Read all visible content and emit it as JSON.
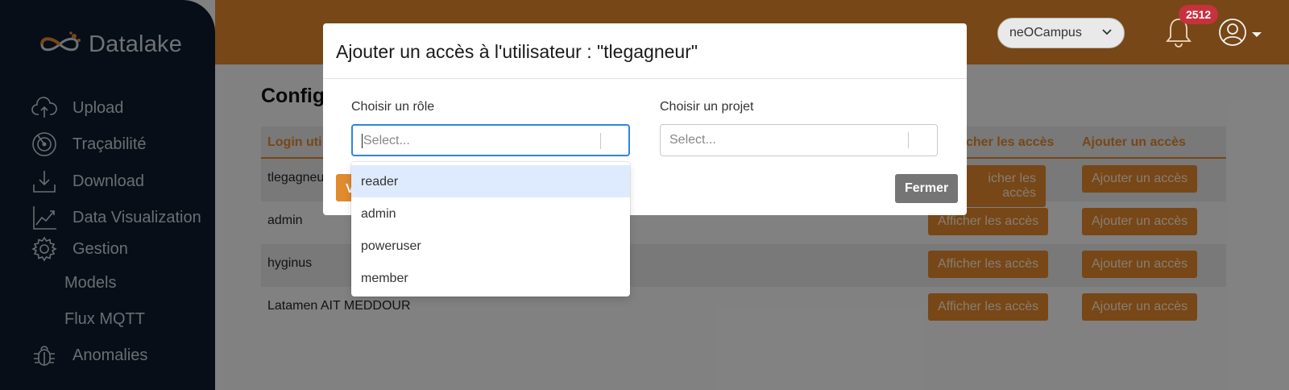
{
  "app": {
    "logo_text": "Datalake"
  },
  "sidebar": {
    "items": [
      {
        "label": "Upload",
        "icon": "cloud-upload-icon"
      },
      {
        "label": "Traçabilité",
        "icon": "target-icon"
      },
      {
        "label": "Download",
        "icon": "download-icon"
      },
      {
        "label": "Data Visualization",
        "icon": "chart-line-icon"
      },
      {
        "label": "Gestion",
        "icon": "gear-icon"
      }
    ],
    "sub_items": [
      {
        "label": "Models"
      },
      {
        "label": "Flux MQTT"
      }
    ],
    "bottom_items": [
      {
        "label": "Anomalies",
        "icon": "bug-icon"
      }
    ]
  },
  "header": {
    "campus_select": "neOCampus",
    "notification_count": "2512",
    "icons": [
      "bell-icon",
      "user-avatar-icon"
    ]
  },
  "page": {
    "title": "Config"
  },
  "table": {
    "headers": {
      "login": "Login uti",
      "show": "cher les accès",
      "add": "Ajouter un accès"
    },
    "rows": [
      {
        "login": "tlegagneu",
        "show": "icher les accès",
        "add": "Ajouter un accès"
      },
      {
        "login": "admin",
        "show": "Afficher les accès",
        "add": "Ajouter un accès"
      },
      {
        "login": "hyginus",
        "show": "Afficher les accès",
        "add": "Ajouter un accès"
      },
      {
        "login": "Latamen AIT MEDDOUR",
        "show": "Afficher les accès",
        "add": "Ajouter un accès"
      }
    ]
  },
  "modal": {
    "title": "Ajouter un accès à l'utilisateur : \"tlegagneur\"",
    "role_label": "Choisir un rôle",
    "role_placeholder": "Select...",
    "project_label": "Choisir un projet",
    "project_placeholder": "Select...",
    "close_label": "Fermer",
    "validate_label": "V"
  },
  "role_dropdown": {
    "options": [
      "reader",
      "admin",
      "poweruser",
      "member"
    ],
    "highlighted": "reader"
  },
  "colors": {
    "accent": "#d9822b",
    "sidebar_bg": "#0e1a2b",
    "focus_border": "#2e84e6",
    "highlight_option": "#deebff",
    "badge": "#c7313d"
  }
}
